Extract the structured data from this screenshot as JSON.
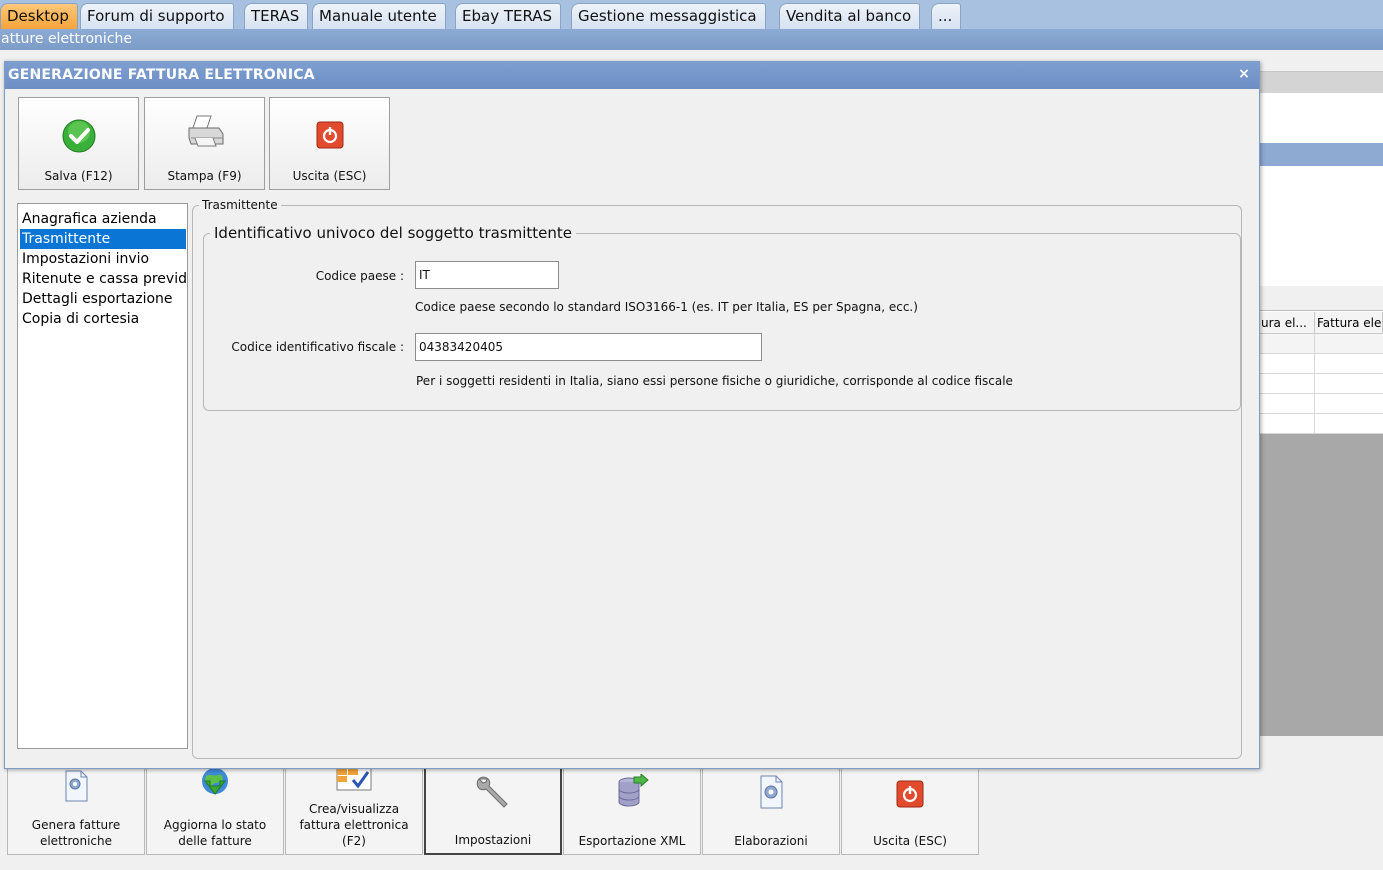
{
  "tabs": [
    "Desktop",
    "Forum di supporto",
    "TERAS",
    "Manuale utente",
    "Ebay TERAS",
    "Gestione messaggistica",
    "Vendita al banco",
    "..."
  ],
  "active_tab": "Desktop",
  "subtitle": "atture elettroniche",
  "background_grid": {
    "headers": [
      "ura el...",
      "Fattura ele"
    ]
  },
  "bottom_toolbar": [
    {
      "label_l1": "Genera fatture",
      "label_l2": "elettroniche",
      "icon": "document-gear-icon"
    },
    {
      "label_l1": "Aggiorna lo stato",
      "label_l2": "delle fatture",
      "icon": "globe-download-icon"
    },
    {
      "label_l1": "Crea/visualizza",
      "label_l2": "fattura elettronica",
      "label_l3": "(F2)",
      "icon": "form-check-icon"
    },
    {
      "label_l1": "Impostazioni",
      "icon": "wrench-icon"
    },
    {
      "label_l1": "Esportazione XML",
      "icon": "database-export-icon"
    },
    {
      "label_l1": "Elaborazioni",
      "icon": "document-gear-icon"
    },
    {
      "label_l1": "Uscita (ESC)",
      "icon": "power-icon"
    }
  ],
  "dialog": {
    "title": "GENERAZIONE FATTURA ELETTRONICA",
    "close": "×",
    "toolbar": {
      "save": "Salva (F12)",
      "print": "Stampa (F9)",
      "exit": "Uscita (ESC)"
    },
    "nav": [
      "Anagrafica azienda",
      "Trasmittente",
      "Impostazioni invio",
      "Ritenute e cassa previdenziale",
      "Dettagli esportazione",
      "Copia di cortesia"
    ],
    "nav_selected": "Trasmittente",
    "section_title": "Trasmittente",
    "group_title": "Identificativo univoco del soggetto trasmittente",
    "fields": {
      "country_label": "Codice paese :",
      "country_value": "IT",
      "country_help": "Codice paese secondo lo standard ISO3166-1 (es. IT per Italia, ES per Spagna, ecc.)",
      "taxid_label": "Codice identificativo fiscale :",
      "taxid_value": "04383420405",
      "taxid_help": "Per i soggetti residenti in Italia, siano essi persone fisiche o giuridiche, corrisponde al codice fiscale"
    }
  },
  "colors": {
    "accent": "#0b75d6",
    "title_bar": "#7e9ed0",
    "active_tab": "#f7a43a"
  }
}
